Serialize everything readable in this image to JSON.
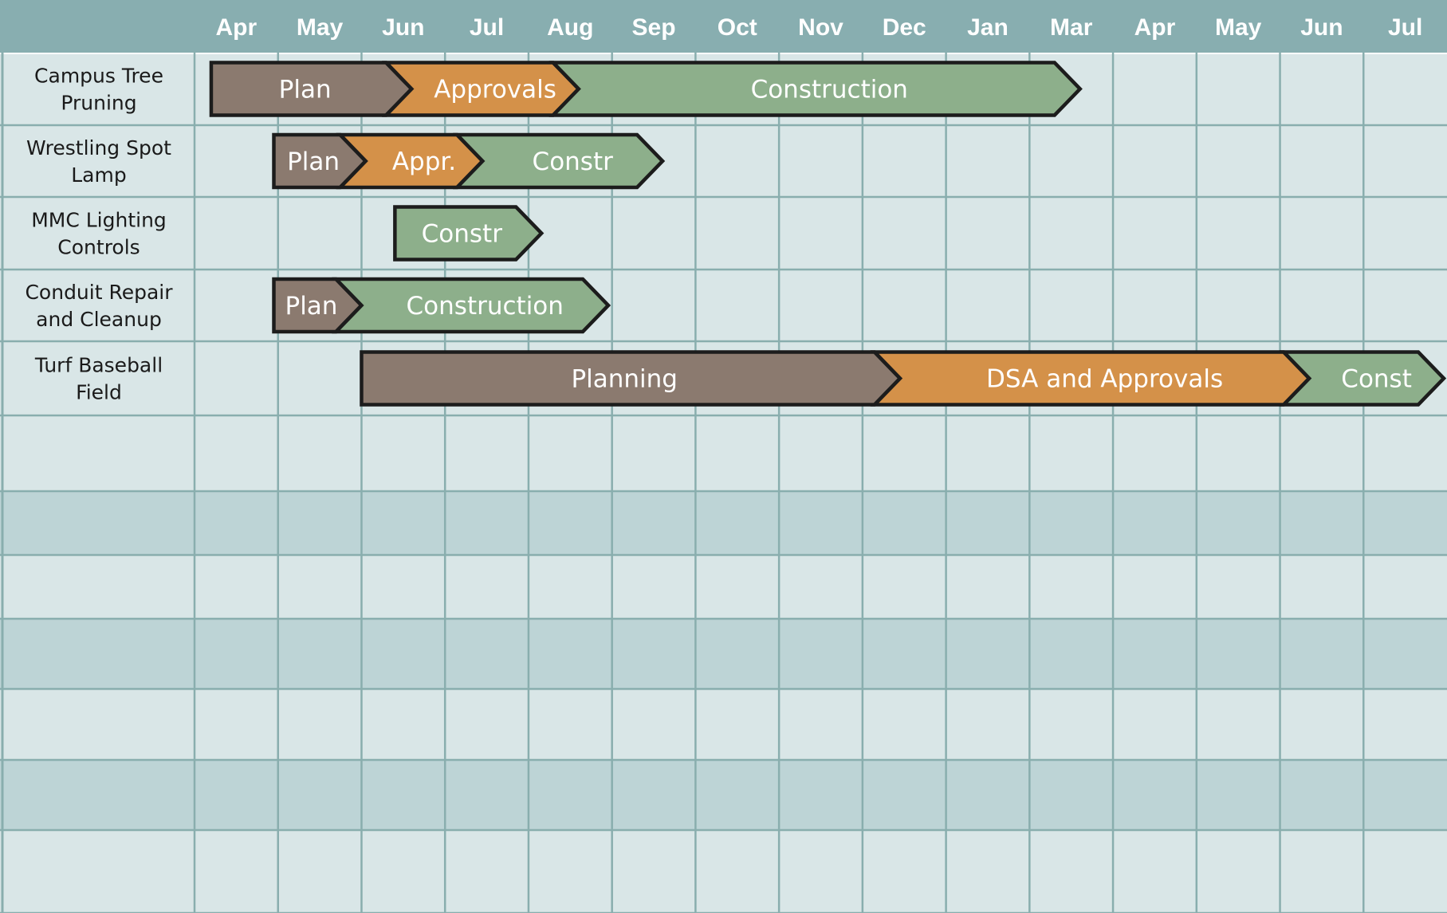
{
  "chart_data": {
    "type": "gantt",
    "months": [
      "Apr",
      "May",
      "Jun",
      "Jul",
      "Aug",
      "Sep",
      "Oct",
      "Nov",
      "Dec",
      "Jan",
      "Mar",
      "Apr",
      "May",
      "Jun",
      "Jul"
    ],
    "rows": [
      {
        "task": [
          "Campus Tree",
          "Pruning"
        ],
        "phases": [
          {
            "label": "Plan",
            "kind": "plan",
            "start": 0.2,
            "end": 2.6
          },
          {
            "label": "Approvals",
            "kind": "approvals",
            "start": 2.6,
            "end": 4.6
          },
          {
            "label": "Construction",
            "kind": "construction",
            "start": 4.6,
            "end": 10.3
          }
        ]
      },
      {
        "task": [
          "Wrestling Spot",
          "Lamp"
        ],
        "phases": [
          {
            "label": "Plan",
            "kind": "plan",
            "start": 0.95,
            "end": 2.05
          },
          {
            "label": "Appr.",
            "kind": "approvals",
            "start": 2.05,
            "end": 3.45
          },
          {
            "label": "Constr",
            "kind": "construction",
            "start": 3.45,
            "end": 5.3
          }
        ]
      },
      {
        "task": [
          "MMC Lighting",
          "Controls"
        ],
        "phases": [
          {
            "label": "Constr",
            "kind": "construction",
            "start": 2.4,
            "end": 3.85
          }
        ]
      },
      {
        "task": [
          "Conduit Repair",
          "and Cleanup"
        ],
        "phases": [
          {
            "label": "Plan",
            "kind": "plan",
            "start": 0.95,
            "end": 2.0
          },
          {
            "label": "Construction",
            "kind": "construction",
            "start": 2.0,
            "end": 4.65
          }
        ]
      },
      {
        "task": [
          "Turf Baseball",
          "Field"
        ],
        "phases": [
          {
            "label": "Planning",
            "kind": "plan",
            "start": 2.0,
            "end": 8.45
          },
          {
            "label": "DSA and Approvals",
            "kind": "approvals",
            "start": 8.45,
            "end": 13.35
          },
          {
            "label": "Const",
            "kind": "construction",
            "start": 13.35,
            "end": 15.0
          }
        ]
      }
    ],
    "empty_rows": 7,
    "colors": {
      "plan": "#8b7a6f",
      "approvals": "#d49149",
      "construction": "#8daf8b",
      "header": "#88aeb0",
      "row_light": "#d9e6e7",
      "row_dark": "#bdd4d6",
      "grid": "#89aeae",
      "outline": "#1c1c1c"
    }
  }
}
